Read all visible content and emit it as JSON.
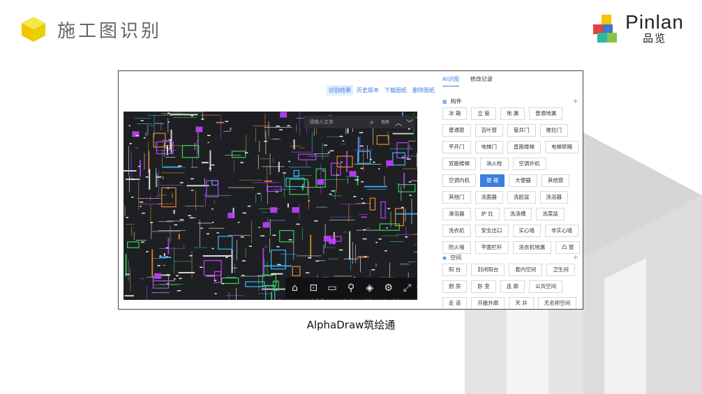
{
  "slide": {
    "title": "施工图识别",
    "caption": "AlphaDraw筑绘通",
    "brand_name": "Pinlan",
    "brand_sub": "品览"
  },
  "top_actions": [
    {
      "label": "识别结果",
      "active": true
    },
    {
      "label": "历史版本",
      "active": false
    },
    {
      "label": "下载图纸",
      "active": false
    },
    {
      "label": "删除图纸",
      "active": false
    }
  ],
  "search": {
    "placeholder": "请输入文本",
    "count": "0/0"
  },
  "toolbar_icons": [
    "home-icon",
    "measure-icon",
    "ruler-icon",
    "pin-icon",
    "layers-icon",
    "settings-icon",
    "fullscreen-icon"
  ],
  "panel": {
    "tabs": [
      {
        "label": "AI识图",
        "active": true
      },
      {
        "label": "修改记录",
        "active": false
      }
    ],
    "sections": [
      {
        "title": "构件",
        "tags": [
          "冰 箱",
          "立 管",
          "地 漏",
          "普通地漏",
          "普通窗",
          "百叶窗",
          "管井门",
          "推拉门",
          "平开门",
          "电梯门",
          "直跑楼梯",
          "电梯轿厢",
          "双跑楼梯",
          "消火栓",
          "空调外机",
          "空调内机",
          "便 器",
          "大便器",
          "其他窗",
          "其他门",
          "洗面器",
          "洗脸盆",
          "洗浴器",
          "淋浴器",
          "炉 灶",
          "洗涤槽",
          "洗菜盆",
          "洗衣机",
          "安全出口",
          "实心墙",
          "非实心墙",
          "防火墙",
          "平面栏杆",
          "洗衣机地漏",
          "凸 窗"
        ],
        "selected": "便 器"
      },
      {
        "title": "空间",
        "tags": [
          "阳 台",
          "封闭阳台",
          "套内空间",
          "卫生间",
          "厨 房",
          "卧 室",
          "连 廊",
          "公共空间",
          "走 道",
          "开敞外廊",
          "天 井",
          "无名称空间"
        ],
        "selected": ""
      }
    ]
  },
  "colors": {
    "accent": "#3b7de0",
    "cad_bg": "#1d1f22",
    "deco_gray": "#d9d9d9"
  }
}
